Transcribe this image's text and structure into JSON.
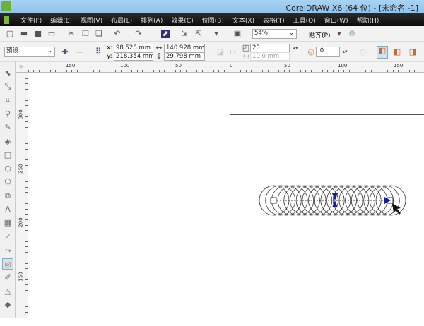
{
  "title": "CorelDRAW X6 (64 位) - [未命名 -1]",
  "menu": [
    "文件(F)",
    "编辑(E)",
    "视图(V)",
    "布局(L)",
    "排列(A)",
    "效果(C)",
    "位图(B)",
    "文本(X)",
    "表格(T)",
    "工具(O)",
    "窗口(W)",
    "帮助(H)"
  ],
  "toolbar": {
    "zoom": "54%",
    "snap": "贴齐(P)"
  },
  "propbar": {
    "preset": "预设...",
    "x": "x:",
    "y": "y:",
    "x_value": "98.528 mm",
    "y_value": "218.354 mm",
    "width": "140.928 mm",
    "height": "29.798 mm",
    "steps": "20",
    "spacing": "10.0 mm",
    "rotation": ".0"
  },
  "ruler": {
    "top": [
      "150",
      "100",
      "50",
      "0",
      "50",
      "100",
      "150"
    ],
    "left": [
      "300",
      "250",
      "200",
      "150"
    ]
  },
  "tools": [
    "pick-tool",
    "shape-tool",
    "crop-tool",
    "zoom-tool",
    "freehand-tool",
    "smart-fill-tool",
    "rectangle-tool",
    "ellipse-tool",
    "polygon-tool",
    "basic-shapes-tool",
    "text-tool",
    "table-tool",
    "dimension-tool",
    "connector-tool",
    "blend-tool",
    "eyedropper-tool",
    "outline-tool",
    "fill-tool"
  ],
  "blend": {
    "steps": 20,
    "accent": "#1a1aa0"
  }
}
